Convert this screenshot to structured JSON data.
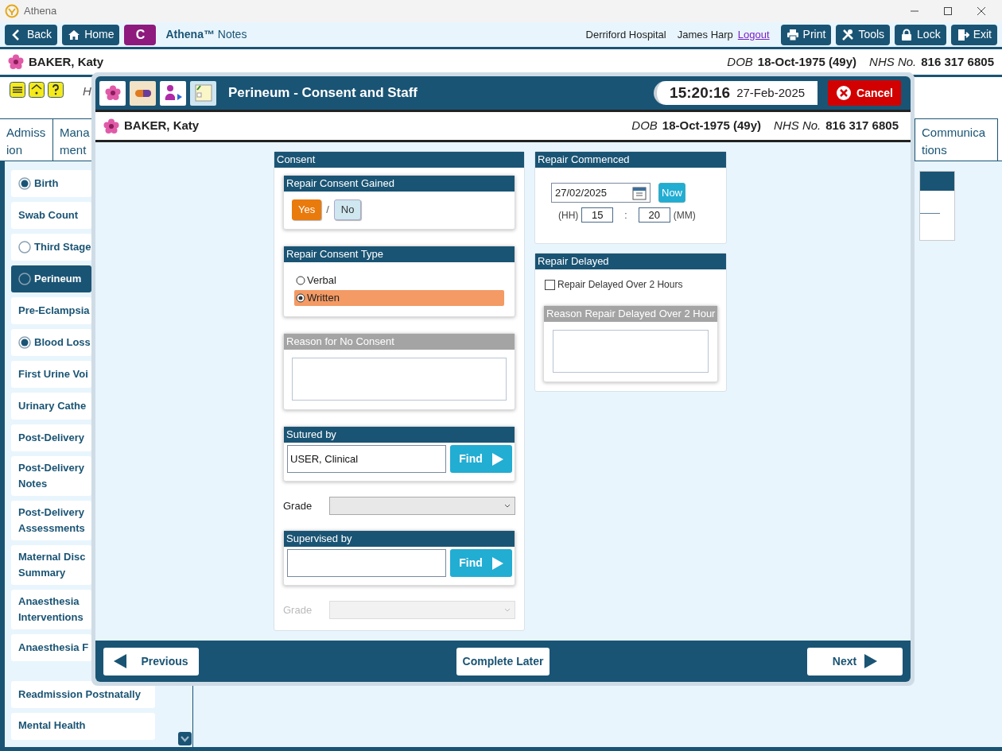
{
  "window": {
    "title": "Athena"
  },
  "toolbar": {
    "left_buttons": [
      {
        "label": "Back",
        "kind": "back"
      },
      {
        "label": "Home",
        "kind": "home"
      },
      {
        "label": "C",
        "kind": "letter"
      }
    ],
    "app_title": "**Athena™** Notes",
    "hospital": "Derriford Hospital",
    "user": "James Harp",
    "logout": "Logout",
    "right_buttons": [
      {
        "label": "Print",
        "kind": "print"
      },
      {
        "label": "Tools",
        "kind": "tools"
      },
      {
        "label": "Lock",
        "kind": "lock"
      },
      {
        "label": "Exit",
        "kind": "exit"
      }
    ]
  },
  "patient": {
    "name": "BAKER, Katy",
    "dob_label": "DOB",
    "dob": "18-Oct-1975 (49y)",
    "nhs_label": "NHS No.",
    "nhs": "816 317 6805"
  },
  "alert_text": "H",
  "tabs": [
    {
      "label": "Admiss\nion"
    },
    {
      "label": "Mana\nment"
    },
    {
      "label": "Communica\ntions"
    }
  ],
  "sidebar": {
    "items": [
      {
        "label": "Birth",
        "kind": "status",
        "complete": true,
        "selected": false
      },
      {
        "label": "Swab Count",
        "kind": "plain",
        "selected": false
      },
      {
        "label": "Third Stage",
        "kind": "status",
        "complete": false,
        "selected": false
      },
      {
        "label": "Perineum",
        "kind": "status",
        "complete": false,
        "selected": true
      },
      {
        "label": "Pre-Eclampsia",
        "kind": "plain",
        "selected": false
      },
      {
        "label": "Blood Loss",
        "kind": "status",
        "complete": true,
        "selected": false
      },
      {
        "label": "First Urine Voi",
        "kind": "plain",
        "selected": false
      },
      {
        "label": "Urinary Cathe",
        "kind": "plain",
        "selected": false
      },
      {
        "label": "Post-Delivery",
        "kind": "plain",
        "selected": false
      },
      {
        "label": "Post-Delivery\nNotes",
        "kind": "plain",
        "selected": false
      },
      {
        "label": "Post-Delivery\nAssessments",
        "kind": "plain",
        "selected": false
      },
      {
        "label": "Maternal Disc\nSummary",
        "kind": "plain",
        "selected": false
      },
      {
        "label": "Anaesthesia\nInterventions",
        "kind": "plain",
        "selected": false
      },
      {
        "label": "Anaesthesia F",
        "kind": "plain",
        "selected": false
      }
    ],
    "more_items": [
      {
        "label": "Readmission Postnatally",
        "selected": false
      },
      {
        "label": "Mental Health",
        "selected": false
      }
    ]
  },
  "dialog": {
    "title": "Perineum - Consent and Staff",
    "time": "15:20:16",
    "date": "27-Feb-2025",
    "cancel": "Cancel",
    "patient": {
      "name": "BAKER, Katy",
      "dob_label": "DOB",
      "dob": "18-Oct-1975 (49y)",
      "nhs_label": "NHS No.",
      "nhs": "816 317 6805"
    },
    "consent": {
      "title": "Consent",
      "gained": {
        "title": "Repair Consent Gained",
        "separator": "/",
        "options": [
          {
            "label": "Yes",
            "selected": true
          },
          {
            "label": "No",
            "selected": false
          }
        ]
      },
      "type": {
        "title": "Repair Consent Type",
        "options": [
          {
            "label": "Verbal",
            "selected": false
          },
          {
            "label": "Written",
            "selected": true
          }
        ]
      },
      "reason": {
        "title": "Reason for No Consent",
        "disabled": true
      },
      "sutured": {
        "title": "Sutured by",
        "value": "USER, Clinical",
        "button": "Find"
      },
      "grade": {
        "label": "Grade",
        "disabled": false
      },
      "supervised": {
        "title": "Supervised by",
        "button": "Find"
      },
      "grade2": {
        "label": "Grade",
        "disabled": true
      }
    },
    "commenced": {
      "title": "Repair Commenced",
      "date": "27/02/2025",
      "now": "Now",
      "hh_label": "(HH)",
      "hh": "15",
      "separator": ":",
      "mm": "20",
      "mm_label": "(MM)"
    },
    "delayed": {
      "title": "Repair Delayed",
      "checkbox": {
        "label": "Repair Delayed Over 2 Hours",
        "checked": false
      },
      "reason": {
        "title": "Reason Repair Delayed Over 2 Hour",
        "disabled": true
      }
    },
    "footer": {
      "previous": "Previous",
      "complete_later": "Complete Later",
      "next": "Next"
    }
  }
}
